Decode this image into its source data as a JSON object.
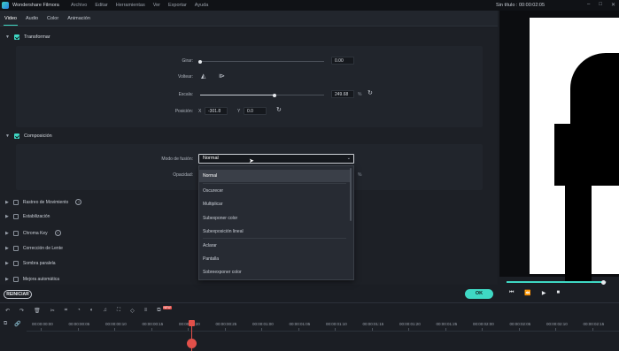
{
  "app": {
    "name": "Wondershare Filmora",
    "doc_title": "Sin título : 00:00:02:05"
  },
  "menu": [
    "Archivo",
    "Editar",
    "Herramientas",
    "Ver",
    "Exportar",
    "Ayuda"
  ],
  "window_controls": [
    "minimize-icon",
    "maximize-icon",
    "close-icon"
  ],
  "tabs": [
    {
      "label": "Video",
      "active": true
    },
    {
      "label": "Audio",
      "active": false
    },
    {
      "label": "Color",
      "active": false
    },
    {
      "label": "Animación",
      "active": false
    }
  ],
  "transform": {
    "title": "Transformar",
    "checked": true,
    "rotate_label": "Girar:",
    "rotate_value": "0.00",
    "rotate_level": 0.0,
    "flip_label": "Voltear:",
    "scale_label": "Escala:",
    "scale_value": "249.68",
    "scale_unit": "%",
    "scale_level": 0.6,
    "position_label": "Posición:",
    "x_label": "X",
    "x_value": "-301.8",
    "y_label": "Y",
    "y_value": "0.0"
  },
  "composition": {
    "title": "Composición",
    "checked": true,
    "blend_label": "Modo de fusión:",
    "blend_value": "Normal",
    "opacity_label": "Opacidad:",
    "opacity_unit": "%"
  },
  "blend_options": [
    "Normal",
    "Oscurecer",
    "Multiplicar",
    "Subexponer color",
    "Subexposición lineal",
    "Aclarar",
    "Pantalla",
    "Sobreexponer color"
  ],
  "sections": [
    {
      "label": "Rastreo de Movimiento",
      "info": true
    },
    {
      "label": "Estabilización",
      "info": false
    },
    {
      "label": "Chroma Key",
      "info": true
    },
    {
      "label": "Corrección de Lente",
      "info": false
    },
    {
      "label": "Sombra paralela",
      "info": false
    },
    {
      "label": "Mejora automática",
      "info": false
    }
  ],
  "buttons": {
    "reset": "REINICIAR",
    "ok": "OK"
  },
  "preview": {
    "progress": 0.97
  },
  "toolbar_icons": [
    "undo-icon",
    "redo-icon",
    "delete-icon",
    "cut-icon",
    "crop-icon",
    "speed-icon",
    "color-icon",
    "audio-icon",
    "fullscreen-icon",
    "keyframe-icon",
    "split-icon",
    "ai-icon"
  ],
  "toolbar_badge": "NEW",
  "timeline": {
    "timecodes": [
      "00:00:00:00",
      "00:00:00:05",
      "00:00:00:10",
      "00:00:00:15",
      "00:00:00:20",
      "00:00:00:25",
      "00:00:01:00",
      "00:00:01:05",
      "00:00:01:10",
      "00:00:01:15",
      "00:00:01:20",
      "00:00:01:25",
      "00:00:02:00",
      "00:00:02:05",
      "00:00:02:10",
      "00:00:02:15"
    ]
  }
}
